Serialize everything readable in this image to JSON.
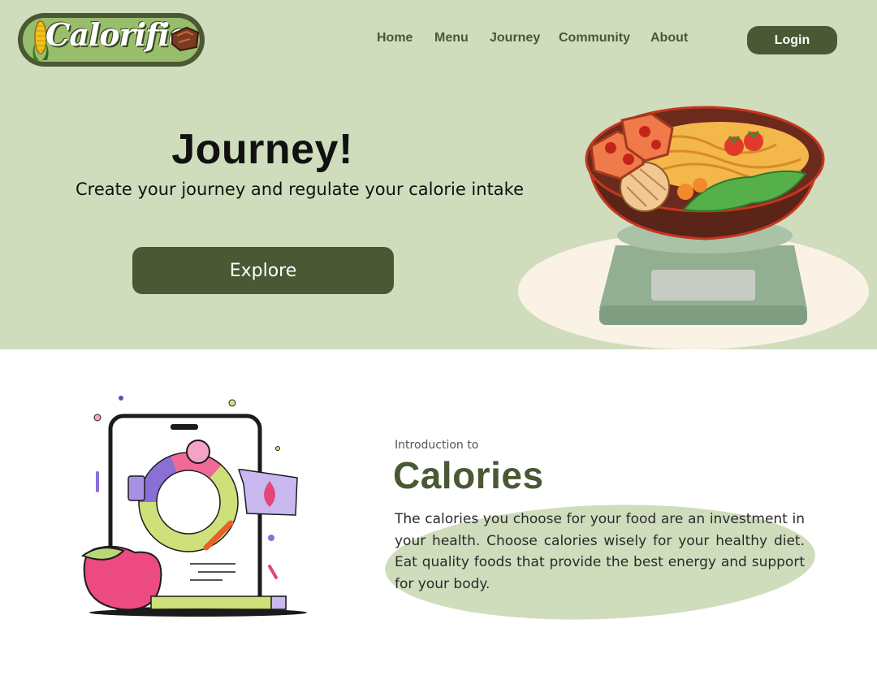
{
  "brand": {
    "logo_text": "Calorific"
  },
  "nav": {
    "items": [
      "Home",
      "Menu",
      "Journey",
      "Community",
      "About"
    ],
    "login_label": "Login"
  },
  "hero": {
    "title": "Journey!",
    "subtitle": "Create your journey and regulate your calorie intake",
    "cta_label": "Explore"
  },
  "intro": {
    "label": "Introduction to",
    "title": "Calories",
    "body": "The calories you choose for your food are an investment in your health. Choose calories wisely for your healthy diet. Eat quality foods that provide the best energy and support for your body."
  },
  "colors": {
    "hero_bg": "#d0ddbc",
    "primary": "#4a5833",
    "text": "#111111"
  },
  "icons": [
    "corn-icon",
    "meat-icon",
    "food-bowl-illustration",
    "phone-nutrition-illustration"
  ]
}
